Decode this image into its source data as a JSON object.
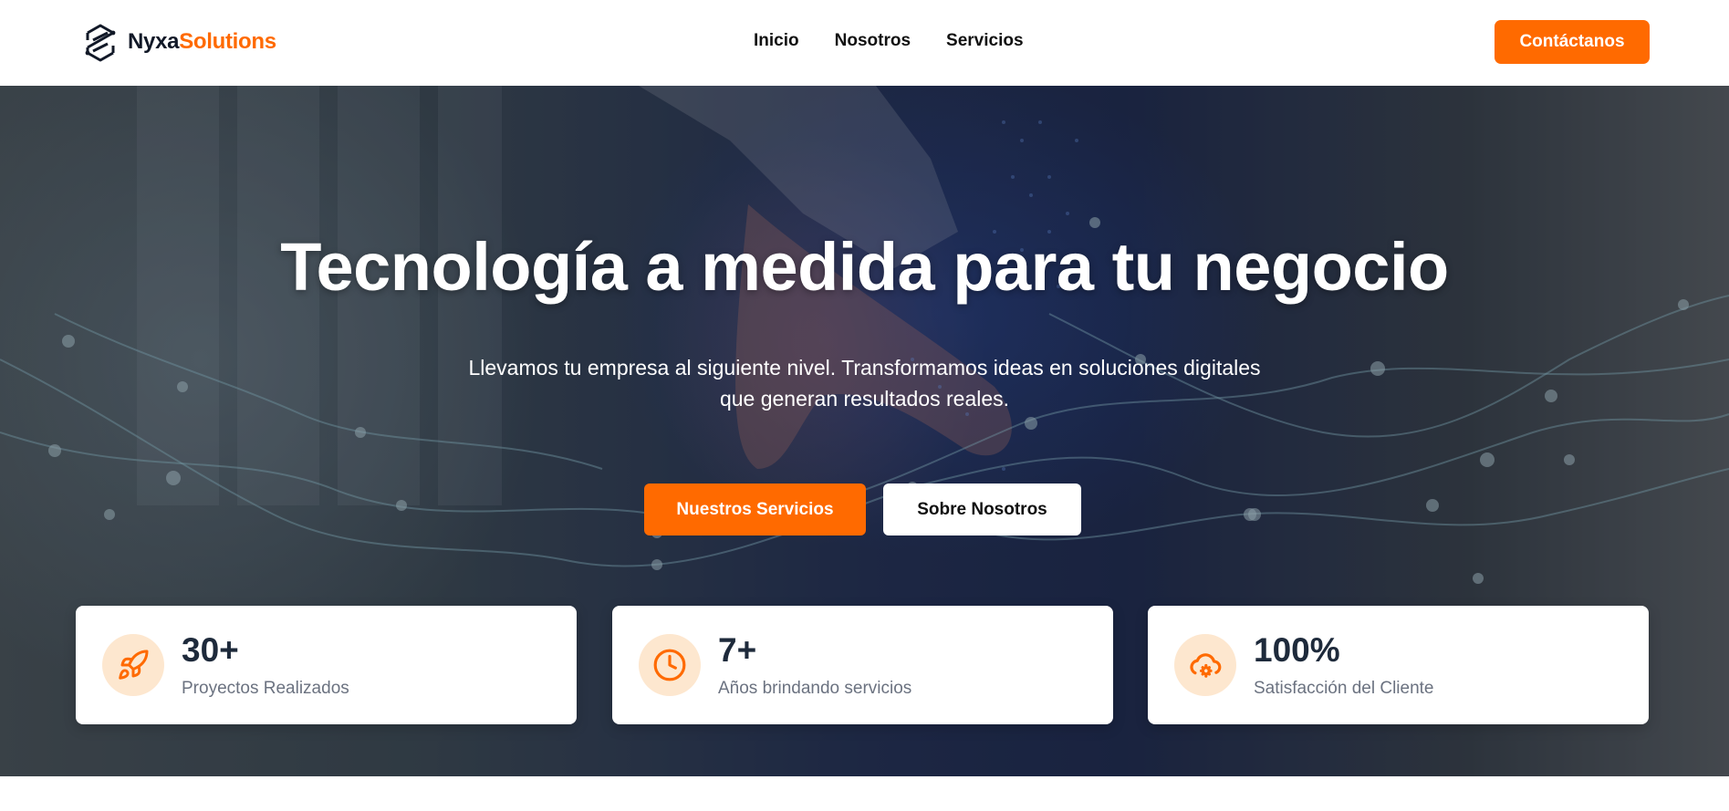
{
  "header": {
    "logo": {
      "text_primary": "Nyxa",
      "text_accent": "Solutions"
    },
    "nav": [
      {
        "label": "Inicio"
      },
      {
        "label": "Nosotros"
      },
      {
        "label": "Servicios"
      }
    ],
    "contact_label": "Contáctanos"
  },
  "hero": {
    "title": "Tecnología a medida para tu negocio",
    "subtitle_line1": "Llevamos tu empresa al siguiente nivel. Transformamos ideas en soluciones digitales",
    "subtitle_line2": "que generan resultados reales.",
    "primary_button": "Nuestros Servicios",
    "secondary_button": "Sobre Nosotros"
  },
  "stats": [
    {
      "icon": "rocket-icon",
      "value": "30+",
      "label": "Proyectos Realizados"
    },
    {
      "icon": "clock-icon",
      "value": "7+",
      "label": "Años brindando servicios"
    },
    {
      "icon": "cloud-gear-icon",
      "value": "100%",
      "label": "Satisfacción del Cliente"
    }
  ],
  "colors": {
    "accent": "#ff6a00",
    "icon_bg": "#fde7cf",
    "stat_value": "#1e2a3b",
    "stat_label": "#6b7280"
  }
}
